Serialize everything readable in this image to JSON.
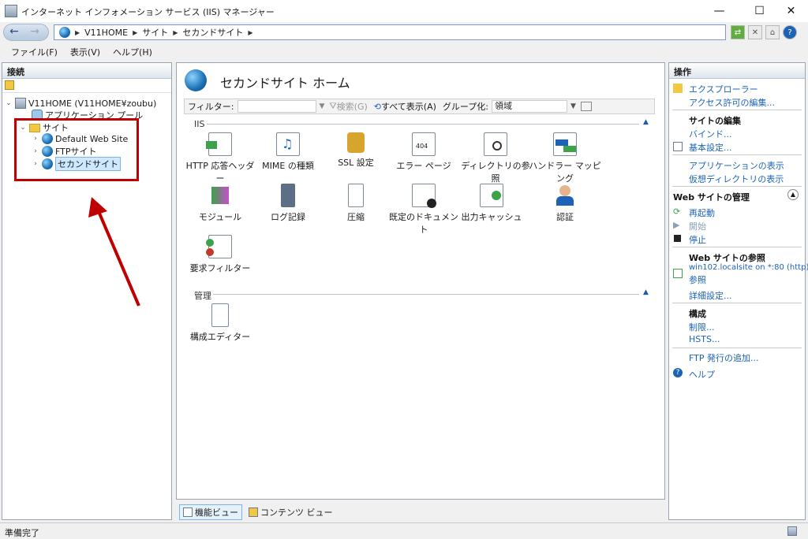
{
  "window": {
    "title": "インターネット インフォメーション サービス (IIS) マネージャー",
    "minimize": "—",
    "maximize": "☐",
    "close": "✕"
  },
  "address": {
    "crumbs": [
      "V11HOME",
      "サイト",
      "セカンドサイト"
    ]
  },
  "menu": {
    "file": "ファイル(F)",
    "view": "表示(V)",
    "help": "ヘルプ(H)"
  },
  "connections": {
    "header": "接続",
    "tree": {
      "server": "V11HOME (V11HOME¥zoubu)",
      "app_pools": "アプリケーション プール",
      "sites": "サイト",
      "site1": "Default Web Site",
      "site2": "FTPサイト",
      "site3": "セカンドサイト"
    }
  },
  "center": {
    "title": "セカンドサイト ホーム",
    "filter_label": "フィルター:",
    "search": "検索(G)",
    "show_all": "すべて表示(A)",
    "group_label": "グループ化:",
    "group_value": "領域",
    "section_iis": "IIS",
    "section_manage": "管理",
    "features": [
      "HTTP 応答ヘッダー",
      "MIME の種類",
      "SSL 設定",
      "エラー ページ",
      "ディレクトリの参照",
      "ハンドラー マッピング",
      "モジュール",
      "ログ記録",
      "圧縮",
      "既定のドキュメント",
      "出力キャッシュ",
      "認証",
      "要求フィルター"
    ],
    "manage_features": [
      "構成エディター"
    ],
    "view_features": "機能ビュー",
    "view_content": "コンテンツ ビュー"
  },
  "actions": {
    "header": "操作",
    "explore": "エクスプローラー",
    "edit_permissions": "アクセス許可の編集...",
    "edit_site": "サイトの編集",
    "bindings": "バインド...",
    "basic_settings": "基本設定...",
    "view_apps": "アプリケーションの表示",
    "view_vdirs": "仮想ディレクトリの表示",
    "manage_site": "Web サイトの管理",
    "restart": "再起動",
    "start": "開始",
    "stop": "停止",
    "browse_site": "Web サイトの参照",
    "browse_link": "win102.localsite on *:80 (http)",
    "browse": "参照",
    "advanced": "詳細設定...",
    "config": "構成",
    "limits": "制限...",
    "hsts": "HSTS...",
    "add_ftp": "FTP 発行の追加...",
    "help": "ヘルプ"
  },
  "status": {
    "text": "準備完了"
  },
  "colors": {
    "annotation": "#c00000",
    "link": "#1c63b7"
  }
}
